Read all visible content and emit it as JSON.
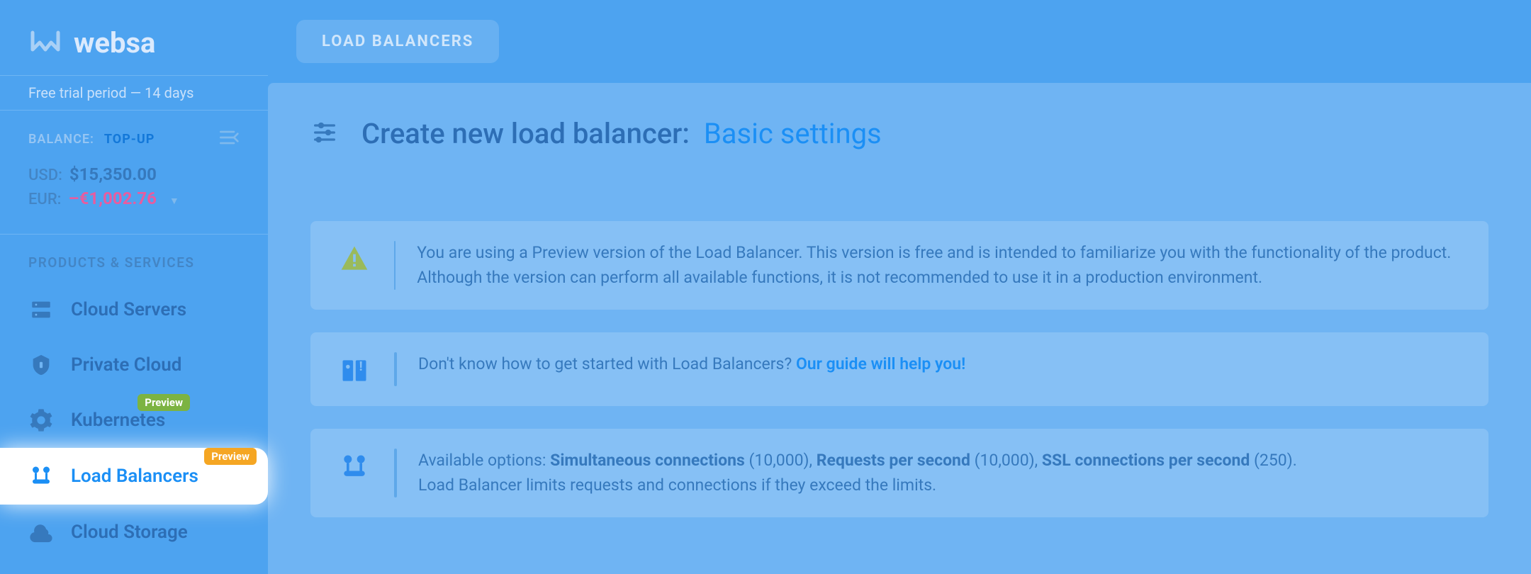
{
  "brand": {
    "name": "websa"
  },
  "trial": {
    "text": "Free trial period — 14 days"
  },
  "balance": {
    "label": "BALANCE:",
    "topup": "TOP-UP",
    "usd_label": "USD:",
    "usd_value": "$15,350.00",
    "eur_label": "EUR:",
    "eur_value": "–€1,002.76"
  },
  "section_products": "PRODUCTS & SERVICES",
  "nav": {
    "cloud_servers": "Cloud Servers",
    "private_cloud": "Private Cloud",
    "kubernetes": "Kubernetes",
    "kubernetes_badge": "Preview",
    "load_balancers": "Load Balancers",
    "load_balancers_badge": "Preview",
    "cloud_storage": "Cloud Storage"
  },
  "breadcrumb": {
    "label": "LOAD BALANCERS"
  },
  "page": {
    "title": "Create new load balancer:",
    "subtitle": "Basic settings"
  },
  "alert_preview": {
    "text": "You are using a Preview version of the Load Balancer. This version is free and is intended to familiarize you with the functionality of the product. Although the version can perform all available functions, it is not recommended to use it in a production environment."
  },
  "alert_guide": {
    "text": "Don't know how to get started with Load Balancers? ",
    "link": "Our guide will help you!"
  },
  "alert_limits": {
    "prefix": "Available options: ",
    "opt1_label": "Simultaneous connections",
    "opt1_val": " (10,000), ",
    "opt2_label": "Requests per second",
    "opt2_val": " (10,000), ",
    "opt3_label": "SSL connections per second",
    "opt3_val": " (250).",
    "line2": "Load Balancer limits requests and connections if they exceed the limits."
  }
}
